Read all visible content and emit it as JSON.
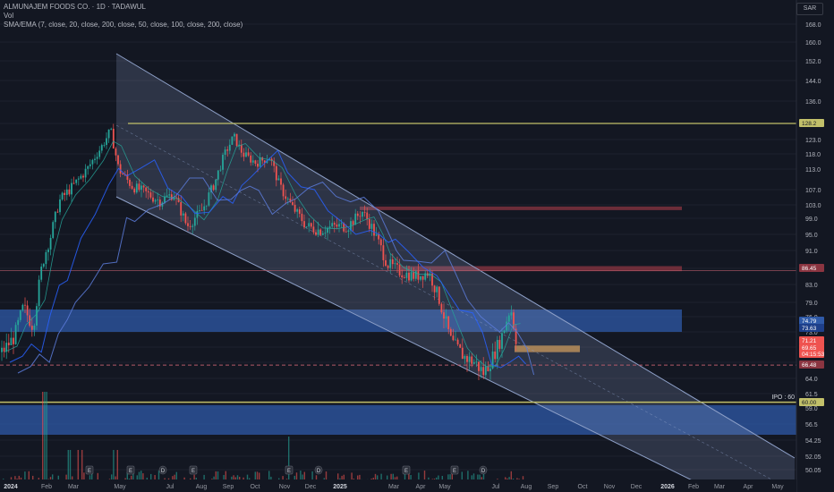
{
  "header": {
    "title": "ALMUNAJEM FOODS CO. · 1D · TADAWUL",
    "vol": "Vol",
    "indicators": "SMA/EMA (7, close, 20, close, 200, close, 50, close, 100, close, 200, close)"
  },
  "currency": "SAR",
  "colors": {
    "bg": "#131722",
    "up": "#26a69a",
    "down": "#ef5350",
    "channel": "#8ea0c8",
    "resistance": "#c2c06a",
    "zone_red": "#8b3541",
    "zone_blue": "#2f5aa8",
    "zone_orange": "#c48a3c",
    "ema_blue": "#2962ff"
  },
  "chart_data": {
    "type": "candlestick",
    "title": "ALMUNAJEM FOODS CO. · 1D · TADAWUL",
    "y_axis": {
      "ticks": [
        168.0,
        160.0,
        152.0,
        144.0,
        136.0,
        128.2,
        123.0,
        118.0,
        113.0,
        107.0,
        103.0,
        99.0,
        95.0,
        91.0,
        87.0,
        83.0,
        79.0,
        76.0,
        73.0,
        70.0,
        67.0,
        64.0,
        61.5,
        59.0,
        56.5,
        54.25,
        52.05,
        50.05
      ]
    },
    "x_axis": {
      "ticks": [
        "2024",
        "Feb",
        "Mar",
        "May",
        "Jul",
        "Aug",
        "Sep",
        "Oct",
        "Nov",
        "Dec",
        "2025",
        "Mar",
        "Apr",
        "May",
        "Jul",
        "Aug",
        "Sep",
        "Oct",
        "Nov",
        "Dec",
        "2026",
        "Feb",
        "Mar",
        "Apr",
        "May"
      ]
    },
    "price_labels": [
      {
        "value": "128.2",
        "color": "#c2c06a"
      },
      {
        "value": "86.45",
        "color": "#8b3541"
      },
      {
        "value": "74.79",
        "color": "#2f5aa8"
      },
      {
        "value": "73.63",
        "color": "#1e3f8a"
      },
      {
        "value": "71.21",
        "color": "#ef5350"
      },
      {
        "value": "69.65",
        "color": "#ef5350"
      },
      {
        "value": "04:15:53",
        "color": "#ef5350"
      },
      {
        "value": "66.48",
        "color": "#8b3541"
      },
      {
        "value": "60.00",
        "color": "#c2c06a"
      }
    ],
    "annotations": [
      {
        "text": "IPO : 60"
      }
    ],
    "horizontal_levels": [
      128.2,
      60.0,
      66.48
    ],
    "zones": [
      {
        "color": "red",
        "from": 101.5,
        "to": 102.5
      },
      {
        "color": "red",
        "from": 86.3,
        "to": 87.5
      },
      {
        "color": "blue",
        "from": 73.0,
        "to": 77.5
      },
      {
        "color": "blue",
        "from": 55.0,
        "to": 59.5
      },
      {
        "color": "orange",
        "from": 69.0,
        "to": 70.3
      }
    ],
    "channel": {
      "upper_start": [
        "May 2024",
        155
      ],
      "upper_end": [
        "May 2026",
        50
      ],
      "lower_start": [
        "May 2024",
        108
      ],
      "lower_end": [
        "May 2026",
        28
      ]
    },
    "close_path": [
      [
        "2024-01",
        69
      ],
      [
        "2024-01-15",
        72
      ],
      [
        "2024-01-25",
        78
      ],
      [
        "2024-02-05",
        74
      ],
      [
        "2024-02-15",
        88
      ],
      [
        "2024-02-25",
        95
      ],
      [
        "2024-03-05",
        104
      ],
      [
        "2024-03-20",
        108
      ],
      [
        "2024-04-05",
        113
      ],
      [
        "2024-04-20",
        120
      ],
      [
        "2024-05-01",
        126
      ],
      [
        "2024-05-10",
        113
      ],
      [
        "2024-05-25",
        108
      ],
      [
        "2024-06-10",
        106
      ],
      [
        "2024-06-25",
        104
      ],
      [
        "2024-07-10",
        106
      ],
      [
        "2024-07-25",
        97
      ],
      [
        "2024-08-10",
        101
      ],
      [
        "2024-08-25",
        109
      ],
      [
        "2024-09-05",
        118
      ],
      [
        "2024-09-15",
        124
      ],
      [
        "2024-09-25",
        118
      ],
      [
        "2024-10-10",
        115
      ],
      [
        "2024-10-25",
        117
      ],
      [
        "2024-11-05",
        108
      ],
      [
        "2024-11-20",
        102
      ],
      [
        "2024-12-05",
        97
      ],
      [
        "2024-12-20",
        96
      ],
      [
        "2025-01-05",
        97
      ],
      [
        "2025-01-20",
        97
      ],
      [
        "2025-02-05",
        101
      ],
      [
        "2025-02-15",
        97
      ],
      [
        "2025-02-25",
        92
      ],
      [
        "2025-03-05",
        88
      ],
      [
        "2025-03-20",
        86
      ],
      [
        "2025-04-05",
        85
      ],
      [
        "2025-04-20",
        86
      ],
      [
        "2025-05-01",
        80
      ],
      [
        "2025-05-15",
        71
      ],
      [
        "2025-05-30",
        68
      ],
      [
        "2025-06-10",
        67
      ],
      [
        "2025-06-20",
        65
      ],
      [
        "2025-06-30",
        68
      ],
      [
        "2025-07-10",
        72
      ],
      [
        "2025-07-20",
        78
      ],
      [
        "2025-07-28",
        69.65
      ]
    ]
  }
}
